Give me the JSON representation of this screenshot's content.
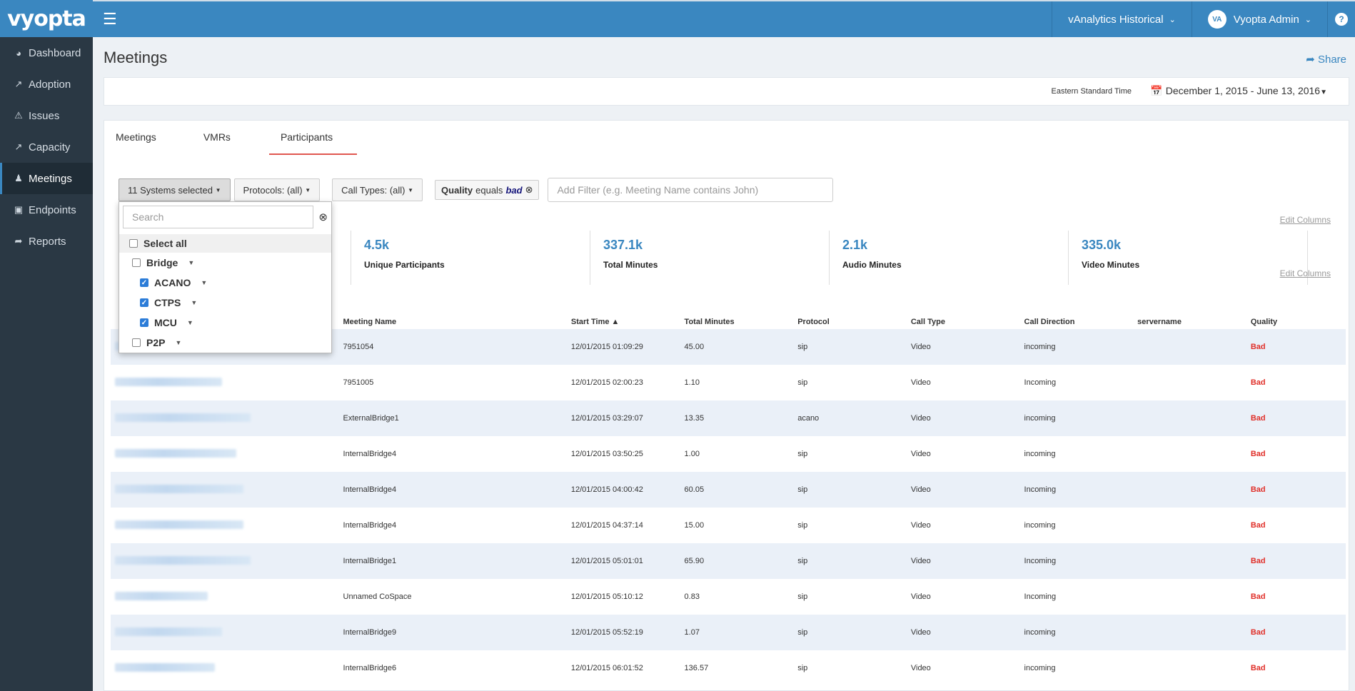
{
  "sidebar": {
    "logo": "vyopta",
    "items": [
      {
        "label": "Dashboard",
        "icon": "dashboard-icon"
      },
      {
        "label": "Adoption",
        "icon": "line-chart-icon"
      },
      {
        "label": "Issues",
        "icon": "warning-icon"
      },
      {
        "label": "Capacity",
        "icon": "area-chart-icon"
      },
      {
        "label": "Meetings",
        "icon": "users-icon"
      },
      {
        "label": "Endpoints",
        "icon": "desktop-icon"
      },
      {
        "label": "Reports",
        "icon": "share-icon"
      }
    ],
    "active": "Meetings"
  },
  "topbar": {
    "product": "vAnalytics Historical",
    "avatar_initials": "VA",
    "user": "Vyopta Admin",
    "help": "?"
  },
  "page": {
    "title": "Meetings",
    "share_label": "Share",
    "timezone": "Eastern Standard Time",
    "date_range": "December 1, 2015 - June 13, 2016"
  },
  "tabs": [
    "Meetings",
    "VMRs",
    "Participants"
  ],
  "filters": {
    "systems": "11 Systems selected",
    "protocols": "Protocols: (all)",
    "call_types": "Call Types: (all)",
    "chip_field": "Quality",
    "chip_op": "equals",
    "chip_value": "bad",
    "add_filter_placeholder": "Add Filter (e.g. Meeting Name contains John)"
  },
  "edit_columns_label": "Edit Columns",
  "stats": [
    {
      "value": "4.5k",
      "label": "Unique Participants"
    },
    {
      "value": "337.1k",
      "label": "Total Minutes"
    },
    {
      "value": "2.1k",
      "label": "Audio Minutes"
    },
    {
      "value": "335.0k",
      "label": "Video Minutes"
    }
  ],
  "dropdown": {
    "search_placeholder": "Search",
    "select_all": "Select all",
    "items": [
      {
        "label": "Bridge",
        "checked": false,
        "indent": 0
      },
      {
        "label": "ACANO",
        "checked": true,
        "indent": 1
      },
      {
        "label": "CTPS",
        "checked": true,
        "indent": 1
      },
      {
        "label": "MCU",
        "checked": true,
        "indent": 1
      },
      {
        "label": "P2P",
        "checked": false,
        "indent": 0
      }
    ]
  },
  "table": {
    "columns": [
      "Meeting Name",
      "Start Time",
      "Total Minutes",
      "Protocol",
      "Call Type",
      "Call Direction",
      "servername",
      "Quality"
    ],
    "rows": [
      [
        "7951054",
        "12/01/2015 01:09:29",
        "45.00",
        "sip",
        "Video",
        "incoming",
        "",
        "Bad"
      ],
      [
        "7951005",
        "12/01/2015 02:00:23",
        "1.10",
        "sip",
        "Video",
        "Incoming",
        "",
        "Bad"
      ],
      [
        "ExternalBridge1",
        "12/01/2015 03:29:07",
        "13.35",
        "acano",
        "Video",
        "incoming",
        "",
        "Bad"
      ],
      [
        "InternalBridge4",
        "12/01/2015 03:50:25",
        "1.00",
        "sip",
        "Video",
        "incoming",
        "",
        "Bad"
      ],
      [
        "InternalBridge4",
        "12/01/2015 04:00:42",
        "60.05",
        "sip",
        "Video",
        "Incoming",
        "",
        "Bad"
      ],
      [
        "InternalBridge4",
        "12/01/2015 04:37:14",
        "15.00",
        "sip",
        "Video",
        "incoming",
        "",
        "Bad"
      ],
      [
        "InternalBridge1",
        "12/01/2015 05:01:01",
        "65.90",
        "sip",
        "Video",
        "Incoming",
        "",
        "Bad"
      ],
      [
        "Unnamed CoSpace",
        "12/01/2015 05:10:12",
        "0.83",
        "sip",
        "Video",
        "Incoming",
        "",
        "Bad"
      ],
      [
        "InternalBridge9",
        "12/01/2015 05:52:19",
        "1.07",
        "sip",
        "Video",
        "incoming",
        "",
        "Bad"
      ],
      [
        "InternalBridge6",
        "12/01/2015 06:01:52",
        "136.57",
        "sip",
        "Video",
        "incoming",
        "",
        "Bad"
      ]
    ]
  }
}
